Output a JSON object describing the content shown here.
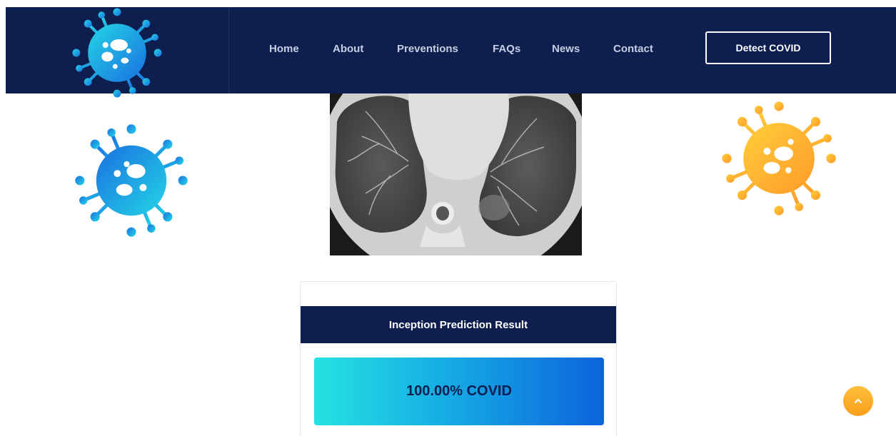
{
  "nav": {
    "items": [
      {
        "label": "Home"
      },
      {
        "label": "About"
      },
      {
        "label": "Preventions"
      },
      {
        "label": "FAQs"
      },
      {
        "label": "News"
      },
      {
        "label": "Contact"
      }
    ],
    "cta_label": "Detect COVID"
  },
  "result": {
    "title": "Inception Prediction Result",
    "value": "100.00% COVID"
  },
  "colors": {
    "navy": "#0e1f4f",
    "cyan": "#25e2e2",
    "blue": "#0c63dc",
    "orange": "#ffa726"
  },
  "icons": {
    "logo": "virus-icon",
    "scroll_top": "chevron-up-icon"
  }
}
